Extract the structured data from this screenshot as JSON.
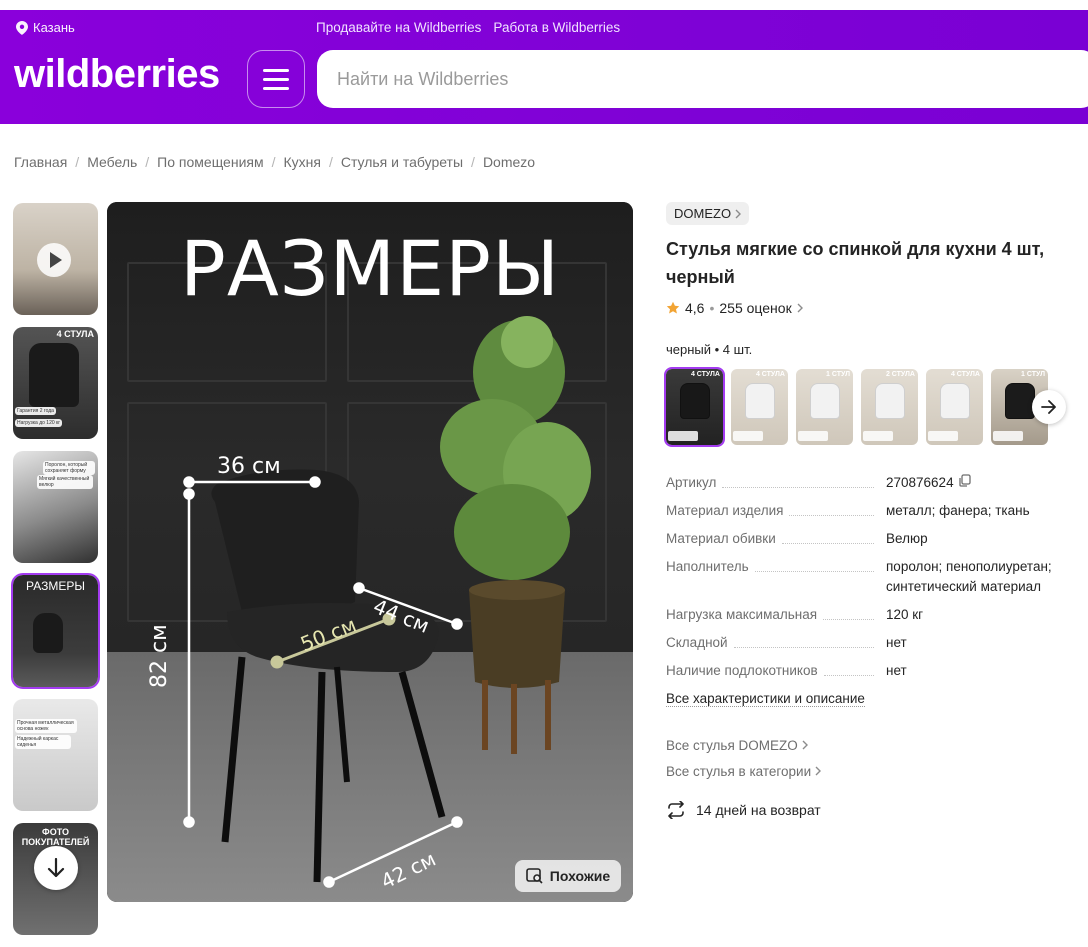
{
  "header": {
    "city": "Казань",
    "links": [
      "Продавайте на Wildberries",
      "Работа в Wildberries"
    ],
    "logo": "wildberries",
    "search_placeholder": "Найти на Wildberries"
  },
  "breadcrumbs": [
    "Главная",
    "Мебель",
    "По помещениям",
    "Кухня",
    "Стулья и табуреты",
    "Domezo"
  ],
  "thumbnails": {
    "t2_top": "4 СТУЛА",
    "t2_badges": [
      "Гарантия 2 года",
      "Нагрузка до 120 кг"
    ],
    "t3_badges": [
      "Поролон, который сохраняет форму",
      "Мягкий качественный велюр"
    ],
    "t4_text": "РАЗМЕРЫ",
    "t5_badges": [
      "Прочная металлическая основа ножек",
      "Надежный каркас сиденья"
    ],
    "t6_text": "ФОТО ПОКУПАТЕЛЕЙ"
  },
  "photo": {
    "title": "РАЗМЕРЫ",
    "dims": {
      "width": "36 см",
      "depth": "44 см",
      "seat": "50 см",
      "height": "82 см",
      "base": "42 см"
    },
    "similar_label": "Похожие"
  },
  "product": {
    "brand": "DOMEZO",
    "title": "Стулья мягкие со спинкой для кухни 4 шт, черный",
    "rating": "4,6",
    "reviews": "255 оценок",
    "variant": "черный • 4 шт.",
    "swatch_tops": [
      "4 СТУЛА",
      "4 СТУЛА",
      "1 СТУЛ",
      "2 СТУЛА",
      "4 СТУЛА",
      "1 СТУЛ"
    ],
    "specs": [
      {
        "k": "Артикул",
        "v": "270876624"
      },
      {
        "k": "Материал изделия",
        "v": "металл; фанера; ткань"
      },
      {
        "k": "Материал обивки",
        "v": "Велюр"
      },
      {
        "k": "Наполнитель",
        "v": "поролон; пенополиуретан; синтетический материал"
      },
      {
        "k": "Нагрузка максимальная",
        "v": "120 кг"
      },
      {
        "k": "Складной",
        "v": "нет"
      },
      {
        "k": "Наличие подлокотников",
        "v": "нет"
      }
    ],
    "all_chars": "Все характеристики и описание",
    "links": [
      "Все стулья DOMEZO",
      "Все стулья в категории"
    ],
    "return_text": "14 дней на возврат"
  },
  "colors": {
    "brand_purple": "#8a00db",
    "active_outline": "#a33bf0",
    "star": "#f2a434"
  }
}
